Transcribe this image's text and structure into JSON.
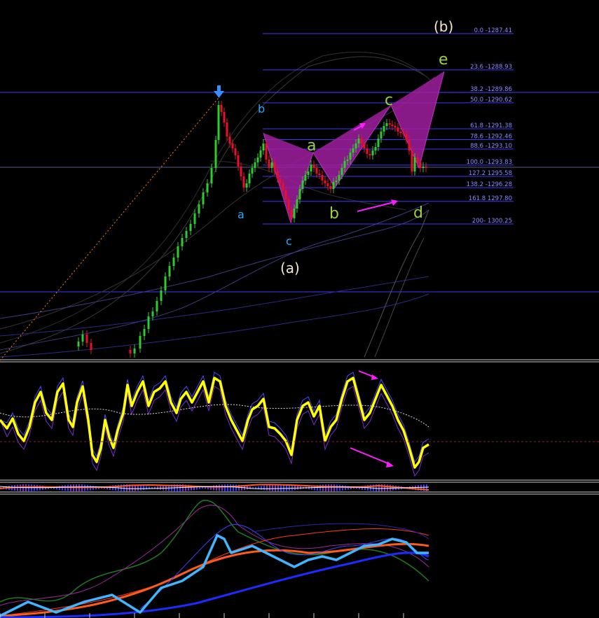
{
  "colors": {
    "background": "#000000",
    "fib_line": "#3a3aff",
    "fib_text": "#8a8aff",
    "candle_up": "#2ecc2e",
    "candle_down": "#e8102a",
    "pattern_fill": "#a01fa0",
    "arrow": "#ff1dff",
    "wave_blue": "#22aaff",
    "wave_green": "#9ad23a",
    "wave_white": "#f5e6c8",
    "stoch_main": "#ffff00",
    "price_panel2_cyan": "#3fb6ff",
    "orange": "#ff5a1a",
    "blue_ma": "#1a2cff"
  },
  "fib_levels": [
    {
      "label": "200- 1300.25"
    },
    {
      "label": "161.8 1297.80"
    },
    {
      "label": "138.2 -1296.28"
    },
    {
      "label": "127.2 1295.58"
    },
    {
      "label": "100.0 -1293.83"
    },
    {
      "label": "88.6 -1293.10"
    },
    {
      "label": "78.6 -1292.46"
    },
    {
      "label": "61.8 -1291.38"
    },
    {
      "label": "50.0 -1290.62"
    },
    {
      "label": "38.2 -1289.86"
    },
    {
      "label": "23.6 -1288.93"
    },
    {
      "label": "0.0 -1287.41"
    }
  ],
  "wave_labels": {
    "big_b": "(b)",
    "big_a": "(a)",
    "left_b": "b",
    "left_a": "a",
    "left_c": "c",
    "green_a": "a",
    "green_b": "b",
    "green_c": "c",
    "green_d": "d",
    "green_e": "e"
  },
  "chart_data": {
    "type": "line",
    "title": "",
    "panels": [
      "price candlesticks with Fibonacci levels",
      "oscillator",
      "histogram",
      "moving averages"
    ],
    "fib_retracement": [
      {
        "ratio": "0.0",
        "price": 1287.41
      },
      {
        "ratio": "23.6",
        "price": 1288.93
      },
      {
        "ratio": "38.2",
        "price": 1289.86
      },
      {
        "ratio": "50.0",
        "price": 1290.62
      },
      {
        "ratio": "61.8",
        "price": 1291.38
      },
      {
        "ratio": "78.6",
        "price": 1292.46
      },
      {
        "ratio": "88.6",
        "price": 1293.1
      },
      {
        "ratio": "100.0",
        "price": 1293.83
      },
      {
        "ratio": "127.2",
        "price": 1295.58
      },
      {
        "ratio": "138.2",
        "price": 1296.28
      },
      {
        "ratio": "161.8",
        "price": 1297.8
      },
      {
        "ratio": "200",
        "price": 1300.25
      }
    ]
  }
}
